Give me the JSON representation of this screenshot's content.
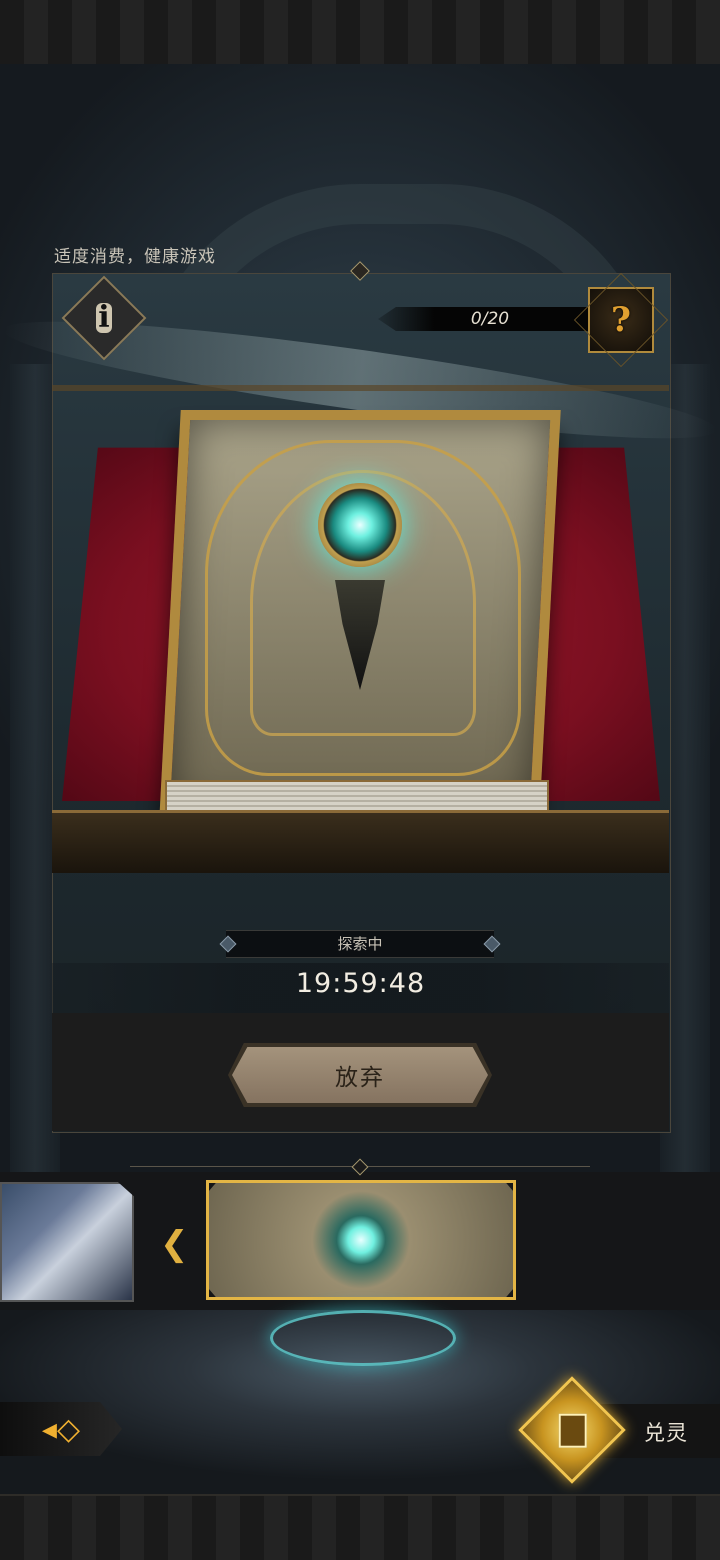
{
  "notice": "适度消费，健康游戏",
  "exploration": {
    "counter": "0/20",
    "status_label": "探索中",
    "timer": "19:59:48",
    "abandon_label": "放弃"
  },
  "icons": {
    "info": "info-icon",
    "mystery": "question-mark-silhouette-icon",
    "prev": "chevron-left-icon",
    "back": "back-arrow-icon",
    "exchange": "card-exchange-icon"
  },
  "footer": {
    "exchange_label": "兑灵"
  },
  "colors": {
    "accent_gold": "#e0b040",
    "cushion_red": "#8a1326",
    "gem_cyan": "#5ef0e0"
  }
}
